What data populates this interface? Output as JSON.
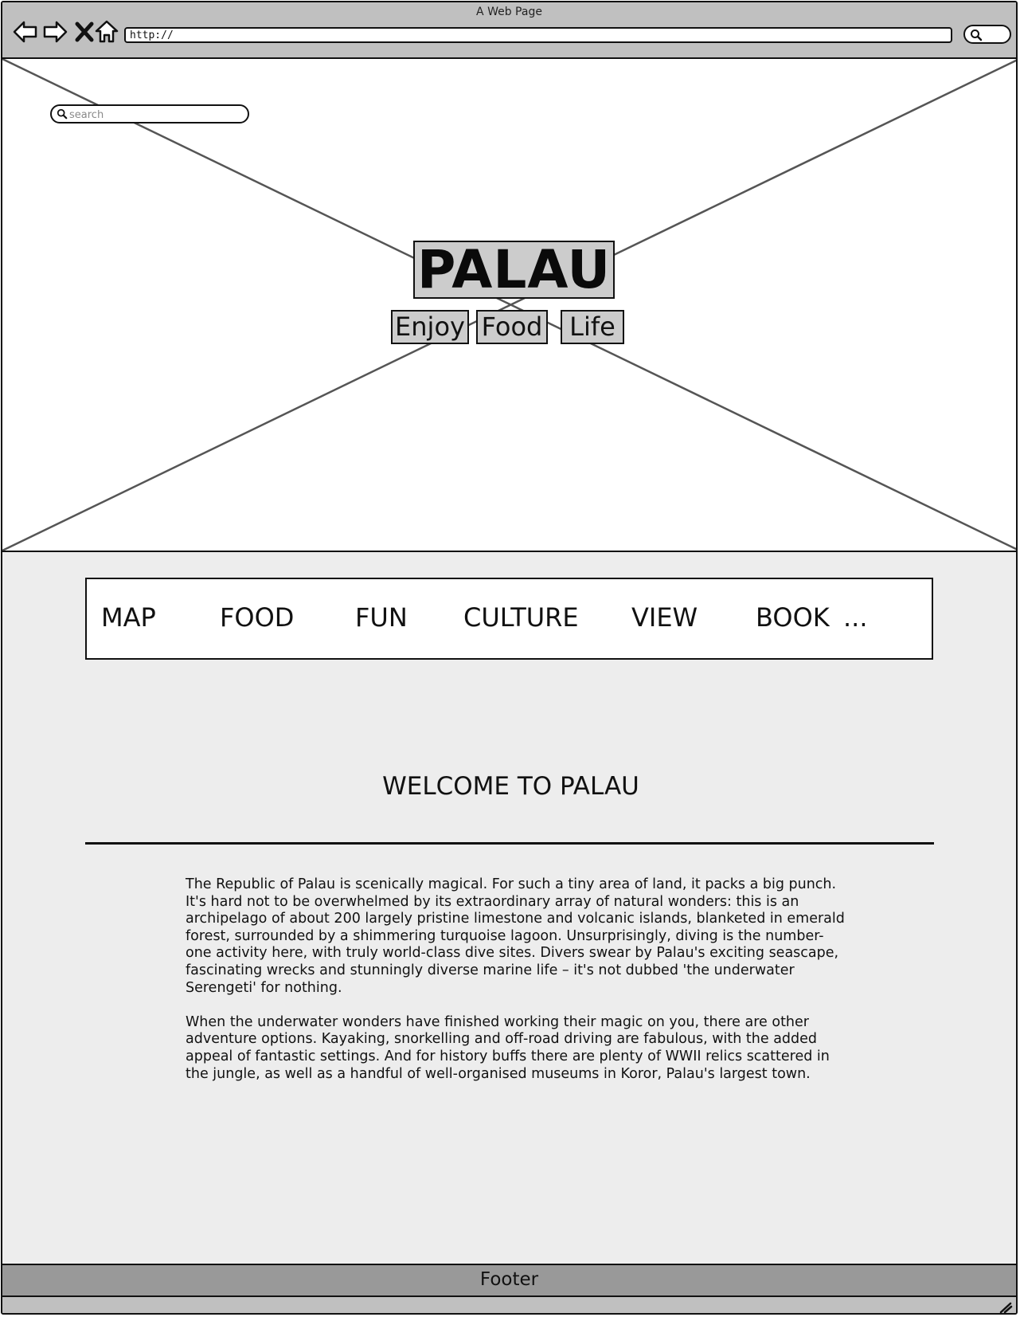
{
  "window": {
    "title": "A Web Page",
    "address": "http://"
  },
  "hero": {
    "search_placeholder": "search",
    "brand": "PALAU",
    "tags": [
      "Enjoy",
      "Food",
      "Life"
    ]
  },
  "nav": {
    "items": [
      "MAP",
      "FOOD",
      "FUN",
      "CULTURE",
      "VIEW",
      "BOOK",
      "..."
    ]
  },
  "main": {
    "heading": "WELCOME TO PALAU",
    "paragraphs": [
      "The Republic of Palau is scenically magical. For such a tiny area of land, it packs a big punch. It's hard not to be overwhelmed by its extraordinary array of natural wonders: this is an archipelago of about 200 largely pristine limestone and volcanic islands, blanketed in emerald forest, surrounded by a shimmering turquoise lagoon. Unsurprisingly, diving is the number-one activity here, with truly world-class dive sites. Divers swear by Palau's exciting seascape, fascinating wrecks and stunningly diverse marine life – it's not dubbed 'the underwater Serengeti' for nothing.",
      "When the underwater wonders have finished working their magic on you, there are other adventure options. Kayaking, snorkelling and off-road driving are fabulous, with the added appeal of fantastic settings. And for history buffs there are plenty of WWII relics scattered in the jungle, as well as a handful of well-organised museums in Koror, Palau's largest town."
    ]
  },
  "footer": {
    "label": "Footer"
  },
  "icons": {
    "back": "back-arrow-icon",
    "forward": "forward-arrow-icon",
    "stop": "close-icon",
    "home": "home-icon",
    "search": "search-icon",
    "resize": "resize-grip-icon"
  },
  "colors": {
    "chrome": "#c0c0c0",
    "page_background": "#ededed",
    "label_box": "#cccccc",
    "footer": "#999999",
    "placeholder_lines": "#555555"
  }
}
